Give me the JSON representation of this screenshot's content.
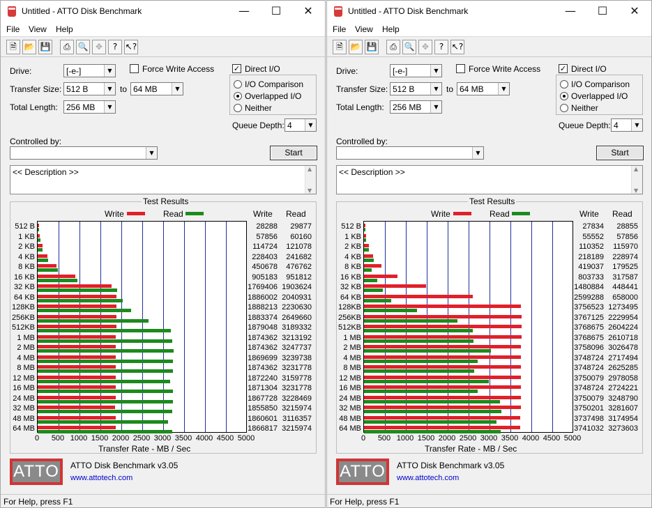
{
  "windows": [
    {
      "title": "Untitled - ATTO Disk Benchmark",
      "menu": [
        "File",
        "View",
        "Help"
      ],
      "drive_label": "Drive:",
      "drive_value": "[-e-]",
      "transfer_size_label": "Transfer Size:",
      "transfer_from": "512 B",
      "to_label": "to",
      "transfer_to": "64 MB",
      "total_length_label": "Total Length:",
      "total_length": "256 MB",
      "force_write": {
        "label": "Force Write Access",
        "checked": false
      },
      "direct_io": {
        "label": "Direct I/O",
        "checked": true
      },
      "io_modes": [
        {
          "label": "I/O Comparison",
          "selected": false
        },
        {
          "label": "Overlapped I/O",
          "selected": true
        },
        {
          "label": "Neither",
          "selected": false
        }
      ],
      "queue_depth_label": "Queue Depth:",
      "queue_depth": "4",
      "controlled_by_label": "Controlled by:",
      "controlled_by": "",
      "start_label": "Start",
      "description": "<< Description >>",
      "results_title": "Test Results",
      "legend_write": "Write",
      "legend_read": "Read",
      "col_write": "Write",
      "col_read": "Read",
      "xlabel": "Transfer Rate - MB / Sec",
      "logo_text": "ATTO",
      "product": "ATTO Disk Benchmark v3.05",
      "url": "www.attotech.com",
      "status": "For Help, press F1"
    },
    {
      "title": "Untitled - ATTO Disk Benchmark",
      "menu": [
        "File",
        "View",
        "Help"
      ],
      "drive_label": "Drive:",
      "drive_value": "[-e-]",
      "transfer_size_label": "Transfer Size:",
      "transfer_from": "512 B",
      "to_label": "to",
      "transfer_to": "64 MB",
      "total_length_label": "Total Length:",
      "total_length": "256 MB",
      "force_write": {
        "label": "Force Write Access",
        "checked": false
      },
      "direct_io": {
        "label": "Direct I/O",
        "checked": true
      },
      "io_modes": [
        {
          "label": "I/O Comparison",
          "selected": false
        },
        {
          "label": "Overlapped I/O",
          "selected": true
        },
        {
          "label": "Neither",
          "selected": false
        }
      ],
      "queue_depth_label": "Queue Depth:",
      "queue_depth": "4",
      "controlled_by_label": "Controlled by:",
      "controlled_by": "",
      "start_label": "Start",
      "description": "<< Description >>",
      "results_title": "Test Results",
      "legend_write": "Write",
      "legend_read": "Read",
      "col_write": "Write",
      "col_read": "Read",
      "xlabel": "Transfer Rate - MB / Sec",
      "logo_text": "ATTO",
      "product": "ATTO Disk Benchmark v3.05",
      "url": "www.attotech.com",
      "status": "For Help, press F1"
    }
  ],
  "colors": {
    "write": "#e0202a",
    "read": "#1d8a1d",
    "grid": "#1f2f9e"
  },
  "chart_data": [
    {
      "type": "bar",
      "orientation": "horizontal",
      "categories": [
        "512 B",
        "1 KB",
        "2 KB",
        "4 KB",
        "8 KB",
        "16 KB",
        "32 KB",
        "64 KB",
        "128KB",
        "256KB",
        "512KB",
        "1 MB",
        "2 MB",
        "4 MB",
        "8 MB",
        "12 MB",
        "16 MB",
        "24 MB",
        "32 MB",
        "48 MB",
        "64 MB"
      ],
      "series": [
        {
          "name": "Write",
          "values": [
            28288,
            57856,
            114724,
            228403,
            450678,
            905183,
            1769406,
            1886002,
            1888213,
            1883374,
            1879048,
            1874362,
            1874362,
            1869699,
            1874362,
            1872240,
            1871304,
            1867728,
            1855850,
            1860601,
            1866817
          ]
        },
        {
          "name": "Read",
          "values": [
            29877,
            60160,
            121078,
            241682,
            476762,
            951812,
            1903624,
            2040931,
            2230630,
            2649660,
            3189332,
            3213192,
            3247737,
            3239738,
            3231778,
            3159778,
            3231778,
            3228469,
            3215974,
            3116357,
            3215974
          ]
        }
      ],
      "xticks": [
        "0",
        "500",
        "1000",
        "1500",
        "2000",
        "2500",
        "3000",
        "3500",
        "4000",
        "4500",
        "5000"
      ],
      "xlim": [
        0,
        5000
      ],
      "xlabel": "Transfer Rate - MB / Sec",
      "grid": true
    },
    {
      "type": "bar",
      "orientation": "horizontal",
      "categories": [
        "512 B",
        "1 KB",
        "2 KB",
        "4 KB",
        "8 KB",
        "16 KB",
        "32 KB",
        "64 KB",
        "128KB",
        "256KB",
        "512KB",
        "1 MB",
        "2 MB",
        "4 MB",
        "8 MB",
        "12 MB",
        "16 MB",
        "24 MB",
        "32 MB",
        "48 MB",
        "64 MB"
      ],
      "series": [
        {
          "name": "Write",
          "values": [
            27834,
            55552,
            110352,
            218189,
            419037,
            803733,
            1480884,
            2599288,
            3756523,
            3767125,
            3768675,
            3768675,
            3758096,
            3748724,
            3748724,
            3750079,
            3748724,
            3750079,
            3750201,
            3737498,
            3741032
          ]
        },
        {
          "name": "Read",
          "values": [
            28855,
            57856,
            115970,
            228974,
            179525,
            317587,
            448441,
            658000,
            1273495,
            2229954,
            2604224,
            2610718,
            3026478,
            2717494,
            2625285,
            2978058,
            2724221,
            3248790,
            3281607,
            3174954,
            3273603
          ]
        }
      ],
      "xticks": [
        "0",
        "500",
        "1000",
        "1500",
        "2000",
        "2500",
        "3000",
        "3500",
        "4000",
        "4500",
        "5000"
      ],
      "xlim": [
        0,
        5000
      ],
      "xlabel": "Transfer Rate - MB / Sec",
      "grid": true
    }
  ]
}
